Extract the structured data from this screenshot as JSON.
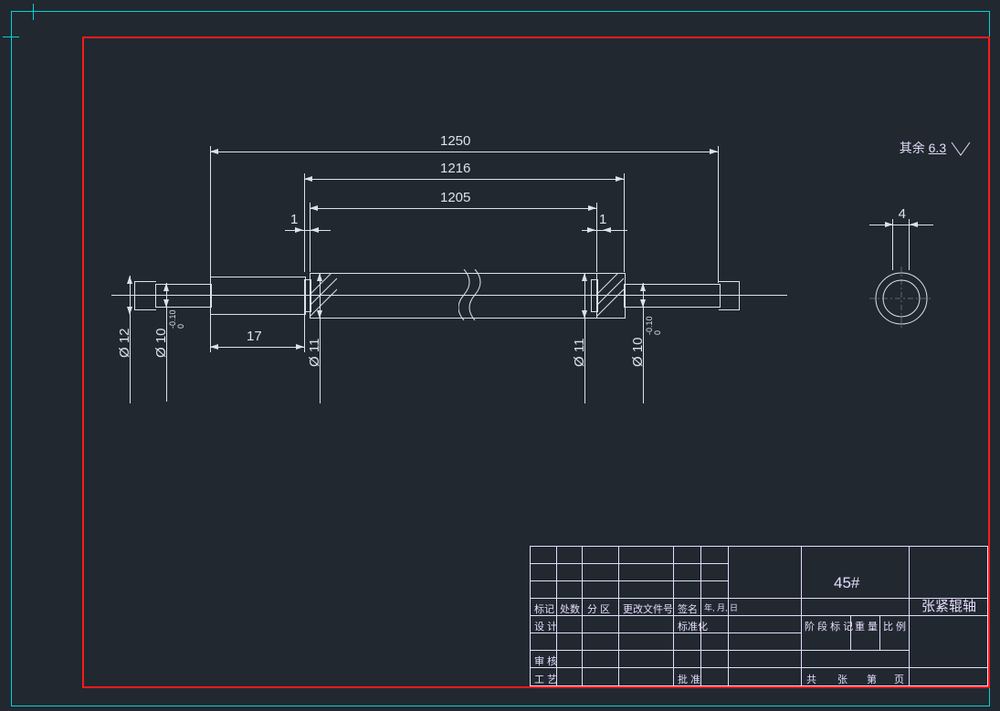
{
  "frame": {
    "surface_note_prefix": "其余",
    "surface_note_value": "6.3"
  },
  "dims": {
    "L1250": "1250",
    "L1216": "1216",
    "L1205": "1205",
    "one_left": "1",
    "one_right": "1",
    "L17": "17",
    "d12": "Ø 12",
    "d10_left": "Ø 10",
    "d10_tol_left": "-0.10\n0",
    "d11_left": "Ø 11",
    "d11_right": "Ø 11",
    "d10_right": "Ø 10",
    "d10_tol_right": "-0.10\n0",
    "ring_w": "4"
  },
  "title_block": {
    "material": "45#",
    "part_name": "张紧辊轴",
    "row_labels": [
      "标记",
      "处数",
      "分 区",
      "更改文件号",
      "签名",
      "年, 月, 日"
    ],
    "row2": [
      "设 计",
      "",
      "",
      "标准化",
      "",
      ""
    ],
    "row3": [
      "审 核",
      "",
      "",
      "",
      "",
      ""
    ],
    "row4": [
      "工 艺",
      "",
      "",
      "批 准",
      "",
      ""
    ],
    "right_col_top": [
      "阶 段 标 记",
      "重 量",
      "比 例"
    ],
    "right_col_bottom": [
      "共",
      "张",
      "第",
      "页"
    ]
  }
}
